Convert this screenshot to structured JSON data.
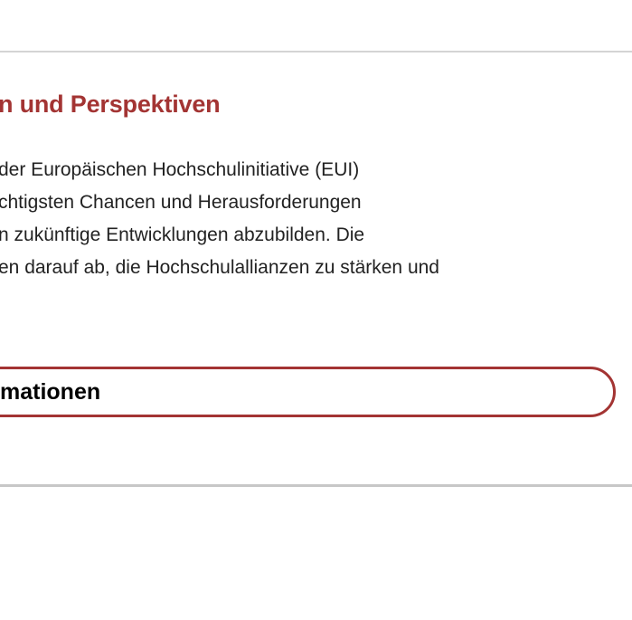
{
  "section": {
    "title": "n und Perspektiven",
    "body_lines": [
      "der Europäischen Hochschulinitiative (EUI)",
      "chtigsten Chancen und Herausforderungen",
      "n zukünftige Entwicklungen abzubilden. Die",
      "en darauf ab, die Hochschulallianzen zu stärken und"
    ]
  },
  "accordion": {
    "label": "mationen"
  },
  "colors": {
    "accent": "#a33433",
    "divider": "#d4d4d4",
    "text": "#222222"
  }
}
